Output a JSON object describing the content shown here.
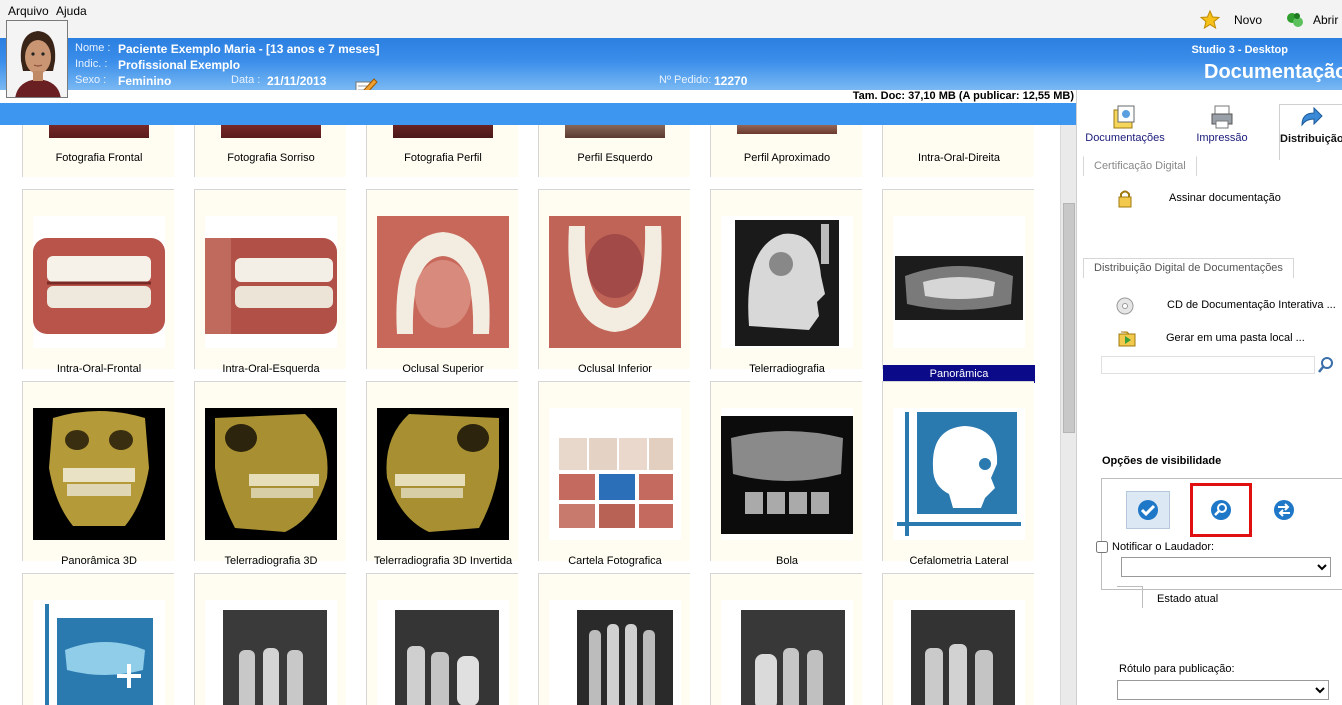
{
  "menu": {
    "file": "Arquivo",
    "help": "Ajuda"
  },
  "toolbar": {
    "new_label": "Novo",
    "open_label": "Abrir"
  },
  "patient": {
    "name_label": "Nome :",
    "name": "Paciente Exemplo Maria - [13 anos e 7 meses]",
    "indic_label": "Indic. :",
    "indic": "Profissional Exemplo",
    "sex_label": "Sexo :",
    "sex": "Feminino",
    "date_label": "Data :",
    "date": "21/11/2013",
    "order_label": "Nº Pedido:",
    "order": "12270"
  },
  "app": {
    "studio": "Studio 3 - Desktop",
    "section_title": "Documentação"
  },
  "doc_size": "Tam. Doc: 37,10 MB (A publicar: 12,55 MB)",
  "grid": {
    "row0": [
      "Fotografia Frontal",
      "Fotografia Sorriso",
      "Fotografia Perfil",
      "Perfil Esquerdo",
      "Perfil Aproximado",
      "Intra-Oral-Direita"
    ],
    "row1": [
      "Intra-Oral-Frontal",
      "Intra-Oral-Esquerda",
      "Oclusal Superior",
      "Oclusal Inferior",
      "Telerradiografia",
      "Panorâmica"
    ],
    "row2": [
      "Panorâmica 3D",
      "Telerradiografia 3D",
      "Telerradiografia 3D Invertida",
      "Cartela Fotografica",
      "Bola",
      "Cefalometria Lateral"
    ],
    "selected": "Panorâmica"
  },
  "panel": {
    "tabs": [
      "Documentações",
      "Impressão",
      "Distribuição"
    ],
    "cert_section": "Certificação Digital",
    "sign_doc": "Assinar documentação",
    "dist_section": "Distribuição Digital de Documentações",
    "cd_item": "CD de Documentação Interativa ...",
    "folder_item": "Gerar em uma pasta local ...",
    "search_value": "",
    "visibility_title": "Opções de visibilidade",
    "notify_label": "Notificar o Laudador:",
    "notify_value": "",
    "state_label": "Estado atual",
    "publish_label": "Rótulo para publicação:",
    "publish_value": ""
  },
  "colors": {
    "header": "#3b8eea",
    "selected": "#0b0b8a",
    "highlight": "#e01010"
  }
}
